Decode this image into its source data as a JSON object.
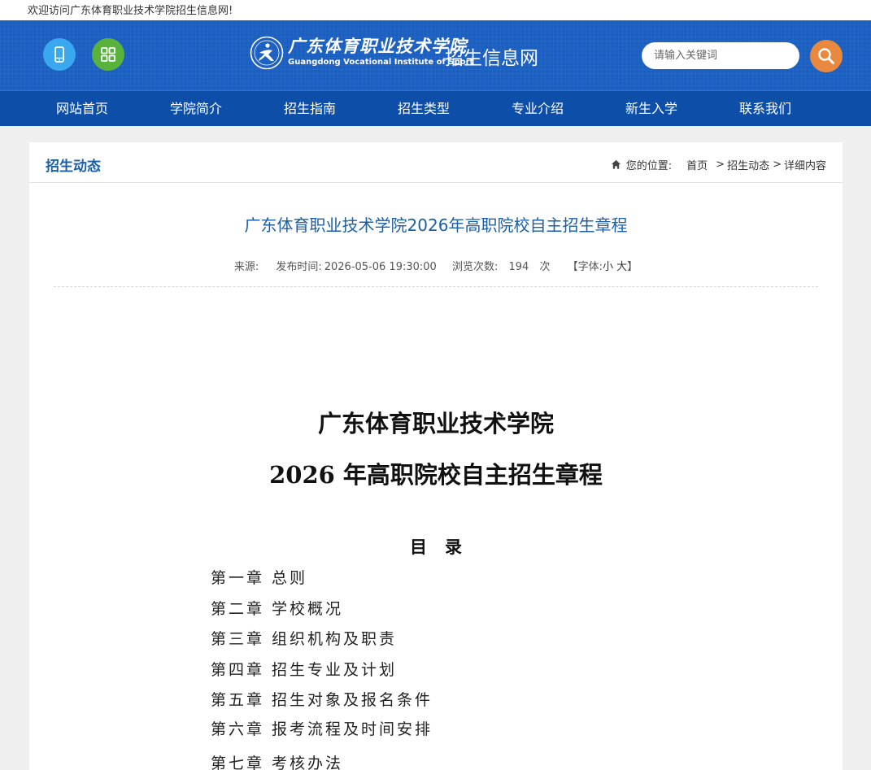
{
  "topbar": {
    "welcome": "欢迎访问广东体育职业技术学院招生信息网!"
  },
  "header": {
    "logo_cn": "广东体育职业技术学院",
    "logo_en": "Guangdong Vocational Institute of Sport",
    "site_name": "招生信息网",
    "search_placeholder": "请输入关键词",
    "colors": {
      "header_bg": "#1b5fc1",
      "nav_bg": "#0c4ea8",
      "mobile_btn": "#3aa8ef",
      "apps_btn": "#59b23c",
      "search_btn": "#e9893f"
    }
  },
  "nav": [
    {
      "label": "网站首页"
    },
    {
      "label": "学院简介"
    },
    {
      "label": "招生指南"
    },
    {
      "label": "招生类型"
    },
    {
      "label": "专业介绍"
    },
    {
      "label": "新生入学"
    },
    {
      "label": "联系我们"
    }
  ],
  "section": {
    "title": "招生动态",
    "breadcrumb": {
      "prefix": "您的位置:",
      "home": "首页",
      "cat": "招生动态",
      "current": "详细内容"
    }
  },
  "article": {
    "title": "广东体育职业技术学院2026年高职院校自主招生章程",
    "source_label": "来源:",
    "publish_label": "发布时间:",
    "publish_time": "2026-05-06 19:30:00",
    "views_label": "浏览次数:",
    "views": "194",
    "views_unit": "次",
    "font_label": "【字体:",
    "font_small": "小",
    "font_large": "大",
    "font_close": "】"
  },
  "document": {
    "title_line1": "广东体育职业技术学院",
    "title_line2": "2026 年高职院校自主招生章程",
    "toc_heading": "目录",
    "toc": [
      "第一章  总则",
      "第二章  学校概况",
      "第三章  组织机构及职责",
      "第四章  招生专业及计划",
      "第五章  招生对象及报名条件",
      "第六章  报考流程及时间安排",
      "第七章  考核办法"
    ]
  }
}
